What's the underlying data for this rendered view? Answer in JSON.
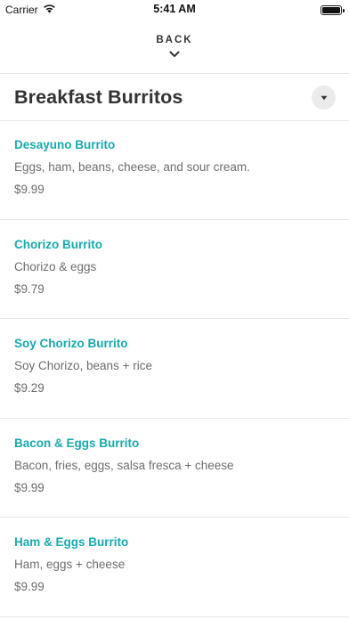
{
  "status_bar": {
    "carrier": "Carrier",
    "time": "5:41 AM"
  },
  "nav": {
    "back_label": "BACK"
  },
  "section": {
    "title": "Breakfast Burritos"
  },
  "colors": {
    "accent": "#16aab0",
    "text_primary": "#333333",
    "text_secondary": "#6d6d6d",
    "divider": "#e6e6e6"
  },
  "icons": {
    "wifi": "wifi-icon",
    "battery": "battery-icon",
    "back": "chevron-down-icon",
    "collapse": "caret-down-icon"
  },
  "items": [
    {
      "name": "Desayuno Burrito",
      "description": "Eggs, ham, beans, cheese, and sour cream.",
      "price": "$9.99"
    },
    {
      "name": "Chorizo Burrito",
      "description": "Chorizo & eggs",
      "price": "$9.79"
    },
    {
      "name": "Soy Chorizo Burrito",
      "description": "Soy Chorizo, beans + rice",
      "price": "$9.29"
    },
    {
      "name": "Bacon & Eggs Burrito",
      "description": "Bacon, fries, eggs, salsa fresca + cheese",
      "price": "$9.99"
    },
    {
      "name": "Ham & Eggs Burrito",
      "description": "Ham, eggs + cheese",
      "price": "$9.99"
    }
  ]
}
